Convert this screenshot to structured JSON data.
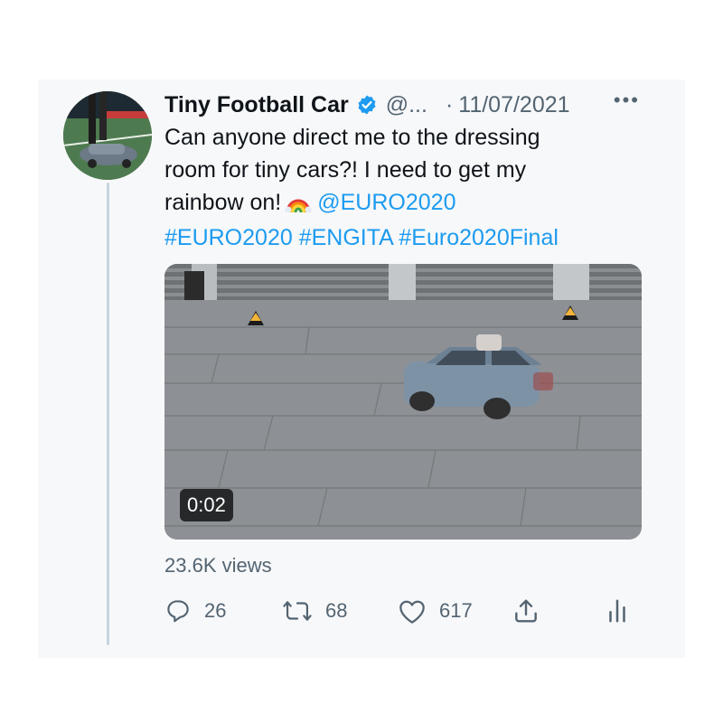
{
  "tweet": {
    "author": {
      "display_name": "Tiny Football Car",
      "handle": "@...",
      "verified": true
    },
    "separator": "·",
    "date": "11/07/2021",
    "more_label": "•••",
    "text": {
      "line1": "Can anyone direct me to the dressing",
      "line2": "room for tiny cars?! I need to get my",
      "line3_prefix": "rainbow on!",
      "line3_mention": "@EURO2020",
      "line4_hashtags": [
        "#EURO2020",
        "#ENGITA",
        "#Euro2020Final"
      ]
    },
    "media": {
      "type": "video",
      "duration": "0:02"
    },
    "views": "23.6K views",
    "actions": {
      "reply": {
        "icon": "reply-icon",
        "count": "26"
      },
      "retweet": {
        "icon": "retweet-icon",
        "count": "68"
      },
      "like": {
        "icon": "heart-icon",
        "count": "617"
      },
      "share": {
        "icon": "share-icon"
      },
      "analytics": {
        "icon": "analytics-icon"
      }
    }
  },
  "colors": {
    "link": "#1d9bf0",
    "text": "#0f1419",
    "secondary": "#536471",
    "verified": "#1d9bf0"
  }
}
